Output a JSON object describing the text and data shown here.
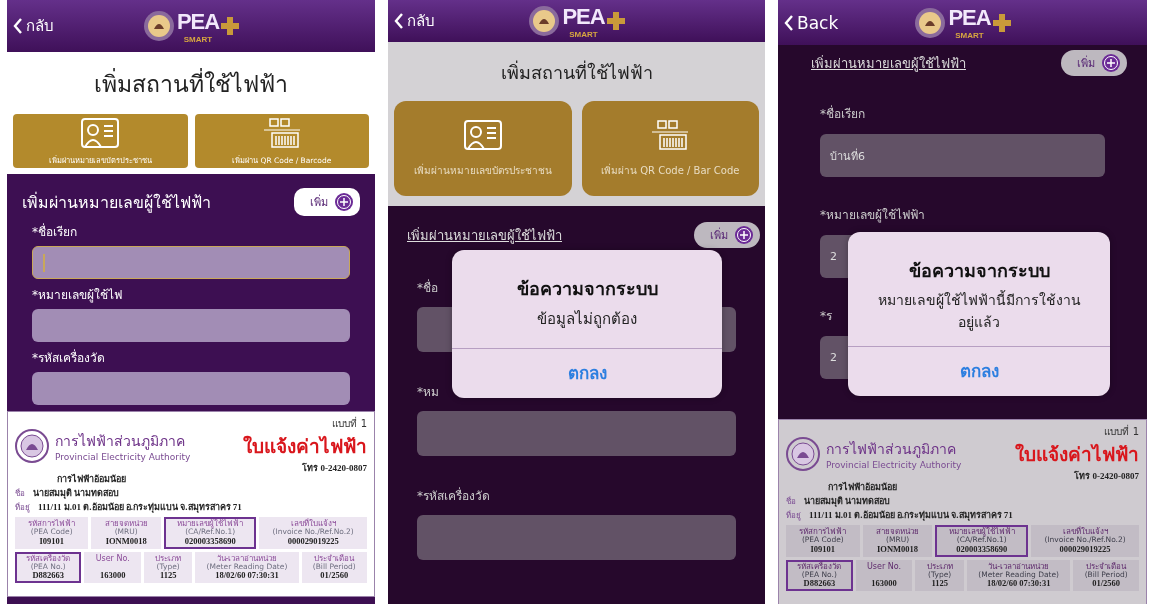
{
  "screens": [
    {
      "back": "กลับ",
      "logo": {
        "title": "PEA",
        "subtitle": "SMART"
      },
      "page_title": "เพิ่มสถานที่ใช้ไฟฟ้า",
      "options": [
        {
          "kind": "id_card",
          "label": "เพิ่มผ่านหมายเลขบัตรประชาชน"
        },
        {
          "kind": "barcode",
          "label": "เพิ่มผ่าน QR Code / Barcode"
        }
      ],
      "section": {
        "title": "เพิ่มผ่านหมายเลขผู้ใช้ไฟฟ้า",
        "underlined": false,
        "add_button": "เพิ่ม"
      },
      "fields": [
        {
          "label": "*ชื่อเรียก",
          "focused": true
        },
        {
          "label": "*หมายเลขผู้ใช้ไฟ",
          "focused": false
        },
        {
          "label": "*รหัสเครื่องวัด",
          "focused": false
        }
      ],
      "bill": {
        "org_th": "การไฟฟ้าส่วนภูมิภาค",
        "org_en": "Provincial Electricity Authority",
        "form_no": "แบบที่ 1",
        "doc_title": "ใบแจ้งค่าไฟฟ้า",
        "branch": "การไฟฟ้าอ้อมน้อย",
        "phone": "โทร 0-2420-0807",
        "name_label": "ชื่อ",
        "name": "นายสมมุติ นามทดสอบ",
        "address_label": "ที่อยู่",
        "address": "111/11 ม.01 ต.อ้อมน้อย อ.กระทุ่มแบน จ.สมุทรสาคร 71",
        "rows": [
          [
            {
              "label": "รหัสการไฟฟ้า",
              "sublabel": "(PEA Code)",
              "value": "I09101",
              "highlighted": false
            },
            {
              "label": "สายจดหน่วย",
              "sublabel": "(MRU)",
              "value": "IONM0018",
              "highlighted": false
            },
            {
              "label": "หมายเลขผู้ใช้ไฟฟ้า",
              "sublabel": "(CA/Ref.No.1)",
              "value": "020003358690",
              "highlighted": true
            },
            {
              "label": "เลขที่ใบแจ้งฯ",
              "sublabel": "(Invoice No./Ref.No.2)",
              "value": "000029019225",
              "highlighted": false
            }
          ],
          [
            {
              "label": "รหัสเครื่องวัด",
              "sublabel": "(PEA No.)",
              "value": "D882663",
              "highlighted": true
            },
            {
              "label": "User No.",
              "value": "163000",
              "highlighted": false
            },
            {
              "label": "ประเภท",
              "sublabel": "(Type)",
              "value": "1125",
              "highlighted": false
            },
            {
              "label": "วัน-เวลาอ่านหน่วย",
              "sublabel": "(Meter Reading Date)",
              "value": "18/02/60 07:30:31",
              "highlighted": false
            },
            {
              "label": "ประจำเดือน",
              "sublabel": "(Bill Period)",
              "value": "01/2560",
              "highlighted": false
            }
          ]
        ]
      }
    },
    {
      "back": "กลับ",
      "logo": {
        "title": "PEA",
        "subtitle": "SMART"
      },
      "page_title": "เพิ่มสถานที่ใช้ไฟฟ้า",
      "options": [
        {
          "kind": "id_card",
          "label": "เพิ่มผ่านหมายเลขบัตรประชาชน"
        },
        {
          "kind": "barcode",
          "label": "เพิ่มผ่าน QR Code / Bar Code"
        }
      ],
      "section": {
        "title": "เพิ่มผ่านหมายเลขผู้ใช้ไฟฟ้า",
        "underlined": true,
        "add_button": "เพิ่ม"
      },
      "fields": [
        {
          "label": "*ชื่อ",
          "focused": false
        },
        {
          "label": "*หม",
          "focused": false
        },
        {
          "label": "*รหัสเครื่องวัด",
          "focused": false
        }
      ],
      "dialog": {
        "title": "ข้อความจากระบบ",
        "message": "ข้อมูลไม่ถูกต้อง",
        "button": "ตกลง"
      }
    },
    {
      "back": "Back",
      "logo": {
        "title": "PEA",
        "subtitle": "SMART"
      },
      "section": {
        "title": "เพิ่มผ่านหมายเลขผู้ใช้ไฟฟ้า",
        "underlined": true,
        "add_button": "เพิ่ม"
      },
      "fields": [
        {
          "label": "*ชื่อเรียก",
          "value": "บ้านที่6",
          "focused": false
        },
        {
          "label": "*หมายเลขผู้ใช้ไฟฟ้า",
          "value": "2",
          "focused": false
        },
        {
          "label": "*ร",
          "value": "2",
          "focused": false
        }
      ],
      "bill": {
        "org_th": "การไฟฟ้าส่วนภูมิภาค",
        "org_en": "Provincial Electricity Authority",
        "form_no": "แบบที่ 1",
        "doc_title": "ใบแจ้งค่าไฟฟ้า",
        "branch": "การไฟฟ้าอ้อมน้อย",
        "phone": "โทร 0-2420-0807",
        "name_label": "ชื่อ",
        "name": "นายสมมุติ นามทดสอบ",
        "address_label": "ที่อยู่",
        "address": "111/11 ม.01 ต.อ้อมน้อย อ.กระทุ่มแบน จ.สมุทรสาคร 71",
        "rows": [
          [
            {
              "label": "รหัสการไฟฟ้า",
              "sublabel": "(PEA Code)",
              "value": "I09101",
              "highlighted": false
            },
            {
              "label": "สายจดหน่วย",
              "sublabel": "(MRU)",
              "value": "IONM0018",
              "highlighted": false
            },
            {
              "label": "หมายเลขผู้ใช้ไฟฟ้า",
              "sublabel": "(CA/Ref.No.1)",
              "value": "020003358690",
              "highlighted": true
            },
            {
              "label": "เลขที่ใบแจ้งฯ",
              "sublabel": "(Invoice No./Ref.No.2)",
              "value": "000029019225",
              "highlighted": false
            }
          ],
          [
            {
              "label": "รหัสเครื่องวัด",
              "sublabel": "(PEA No.)",
              "value": "D882663",
              "highlighted": true
            },
            {
              "label": "User No.",
              "value": "163000",
              "highlighted": false
            },
            {
              "label": "ประเภท",
              "sublabel": "(Type)",
              "value": "1125",
              "highlighted": false
            },
            {
              "label": "วัน-เวลาอ่านหน่วย",
              "sublabel": "(Meter Reading Date)",
              "value": "18/02/60 07:30:31",
              "highlighted": false
            },
            {
              "label": "ประจำเดือน",
              "sublabel": "(Bill Period)",
              "value": "01/2560",
              "highlighted": false
            }
          ]
        ]
      },
      "dialog": {
        "title": "ข้อความจากระบบ",
        "message": "หมายเลขผู้ใช้ไฟฟ้านี้มีการใช้งานอยู่แล้ว",
        "button": "ตกลง"
      }
    }
  ]
}
